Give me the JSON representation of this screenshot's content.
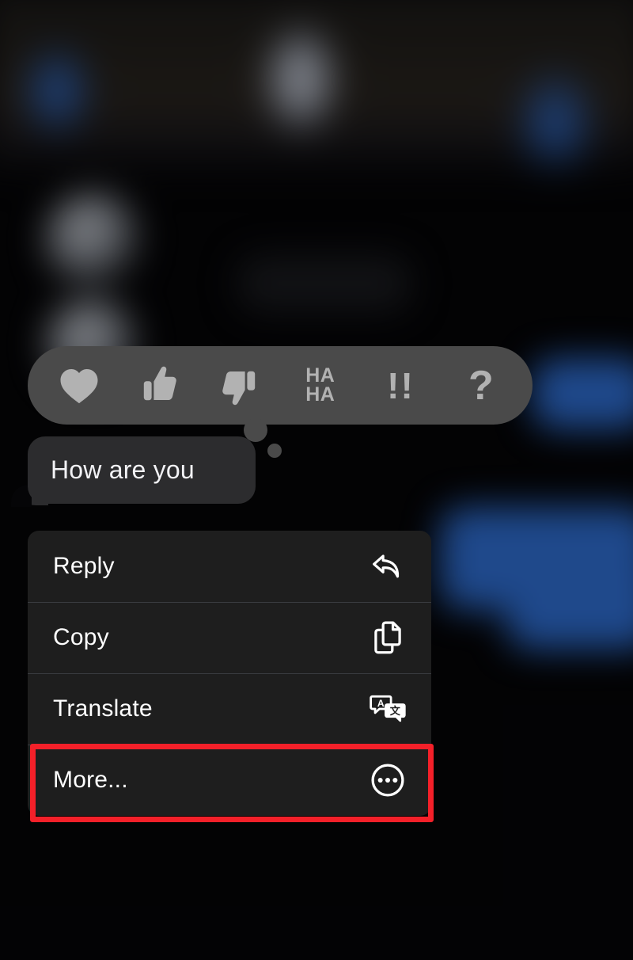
{
  "app": {
    "name": "messaging-app",
    "theme": "dark"
  },
  "message": {
    "text": "How are you",
    "direction": "received",
    "bubble_color": "#2c2c2e",
    "text_color": "#f2f2f5"
  },
  "reaction_bar": {
    "background_color": "#4a4a4a",
    "icon_color": "#b2b2b2",
    "reactions": [
      {
        "id": "love",
        "icon": "heart-icon",
        "label": "Love",
        "kind": "glyph"
      },
      {
        "id": "like",
        "icon": "thumbs-up-icon",
        "label": "Like",
        "kind": "glyph"
      },
      {
        "id": "dislike",
        "icon": "thumbs-down-icon",
        "label": "Dislike",
        "kind": "glyph"
      },
      {
        "id": "laugh",
        "icon": "haha-icon",
        "label": "HA\nHA",
        "line1": "HA",
        "line2": "HA",
        "kind": "text"
      },
      {
        "id": "emphasize",
        "icon": "exclamation-icon",
        "label": "!!",
        "kind": "text"
      },
      {
        "id": "question",
        "icon": "question-mark-icon",
        "label": "?",
        "kind": "text"
      }
    ]
  },
  "context_menu": {
    "background_color": "#1e1e1e",
    "divider_color": "#3a3c40",
    "items": [
      {
        "id": "reply",
        "label": "Reply",
        "icon": "reply-arrow-icon"
      },
      {
        "id": "copy",
        "label": "Copy",
        "icon": "copy-documents-icon"
      },
      {
        "id": "translate",
        "label": "Translate",
        "icon": "translate-icon"
      },
      {
        "id": "more",
        "label": "More...",
        "icon": "ellipsis-circle-icon",
        "highlighted": true
      }
    ]
  },
  "highlight": {
    "target": "More...",
    "color": "#f42029",
    "border_width_px": 7
  },
  "background": {
    "blurred": true,
    "sent_bubble_color": "#2f6fd4",
    "received_bubble_color": "#1b1c20",
    "header_accent_color": "#2f6fd4"
  }
}
